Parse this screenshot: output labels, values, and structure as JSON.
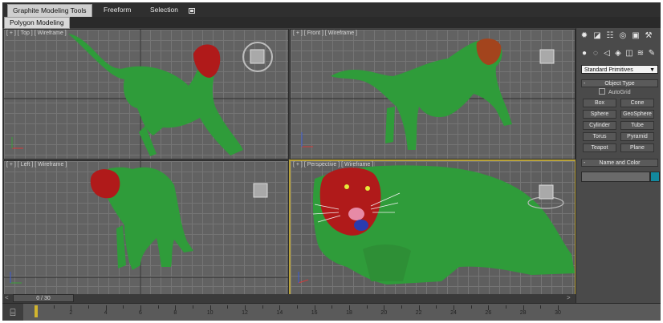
{
  "ribbon": {
    "tabs": [
      "Graphite Modeling Tools",
      "Freeform",
      "Selection"
    ],
    "active_tab": 0,
    "sub_tab": "Polygon Modeling",
    "extra_icon": "toggle-ribbon-icon"
  },
  "viewports": {
    "top": {
      "label": "[ + ] [ Top ] [ Wireframe ]"
    },
    "front": {
      "label": "[ + ] [ Front ] [ Wireframe ]"
    },
    "left": {
      "label": "[ + ] [ Left ] [ Wireframe ]"
    },
    "perspective": {
      "label": "[ + ] [ Perspective ] [ Wireframe ]",
      "active": true
    }
  },
  "command_panel": {
    "tab_icons": [
      "create-icon",
      "modify-icon",
      "hierarchy-icon",
      "motion-icon",
      "display-icon",
      "utilities-icon"
    ],
    "category_icons": [
      "geometry-icon",
      "shapes-icon",
      "lights-icon",
      "cameras-icon",
      "helpers-icon",
      "space-warps-icon",
      "systems-icon"
    ],
    "primitive_type": "Standard Primitives",
    "object_type": {
      "title": "Object Type",
      "autogrid": "AutoGrid",
      "buttons": [
        "Box",
        "Cone",
        "Sphere",
        "GeoSphere",
        "Cylinder",
        "Tube",
        "Torus",
        "Pyramid",
        "Teapot",
        "Plane"
      ]
    },
    "name_and_color": {
      "title": "Name and Color",
      "name_value": "",
      "swatch_color": "#13889e"
    }
  },
  "timeline": {
    "frame_display": "0 / 30",
    "ticks": [
      "0",
      "2",
      "4",
      "6",
      "8",
      "10",
      "12",
      "14",
      "16",
      "18",
      "20",
      "22",
      "24",
      "26",
      "28",
      "30"
    ],
    "current_frame": 0
  },
  "colors": {
    "wireframe": "#2f9c3a",
    "head": "#b01a1a",
    "viewport_bg": "#626262",
    "active_border": "#b8a23a"
  }
}
